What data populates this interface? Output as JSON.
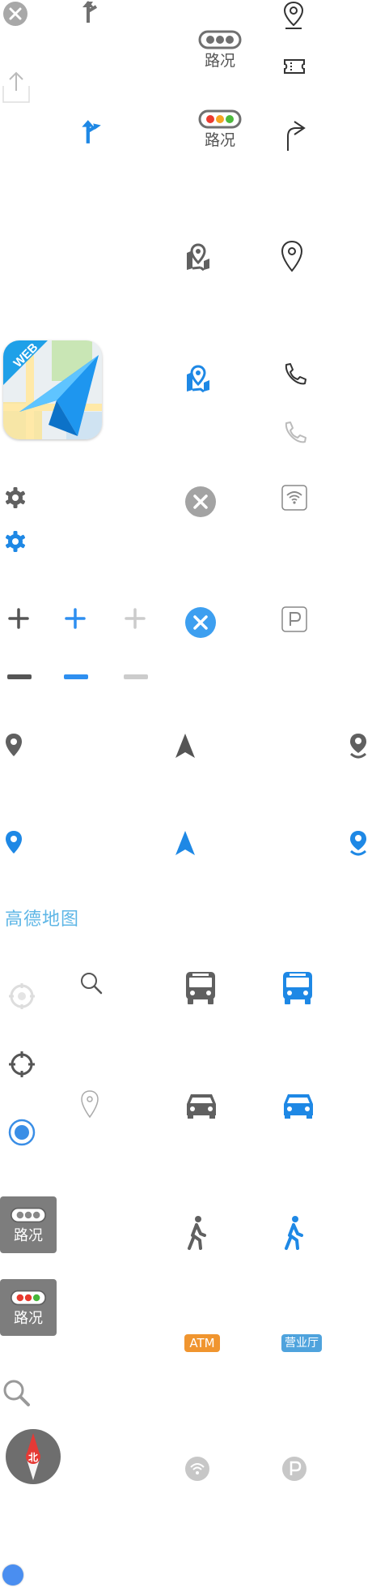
{
  "traffic_label": "路况",
  "brand_text": "高德地图",
  "app_badge": "WEB",
  "atm_label": "ATM",
  "business_hall_label": "营业厅",
  "compass_label": "北",
  "colors": {
    "blue": "#1e88e5",
    "dark_gray": "#606060",
    "light_gray": "#c7c7c7",
    "orange": "#f0952f",
    "tag_blue": "#4fa3dd",
    "brand_blue": "#5eb6e6"
  },
  "icons": [
    "close-icon",
    "turn-left-icon",
    "location-pin-icon",
    "traffic-icon",
    "ticket-icon",
    "share-icon",
    "turn-right-icon",
    "map-pin-icon",
    "app-icon",
    "phone-icon",
    "settings-icon",
    "wifi-icon",
    "parking-icon",
    "zoom-in-icon",
    "zoom-out-icon",
    "navigation-arrow-icon",
    "user-pin-icon",
    "search-icon",
    "bus-icon",
    "car-icon",
    "locate-icon",
    "walk-icon",
    "compass-icon"
  ]
}
